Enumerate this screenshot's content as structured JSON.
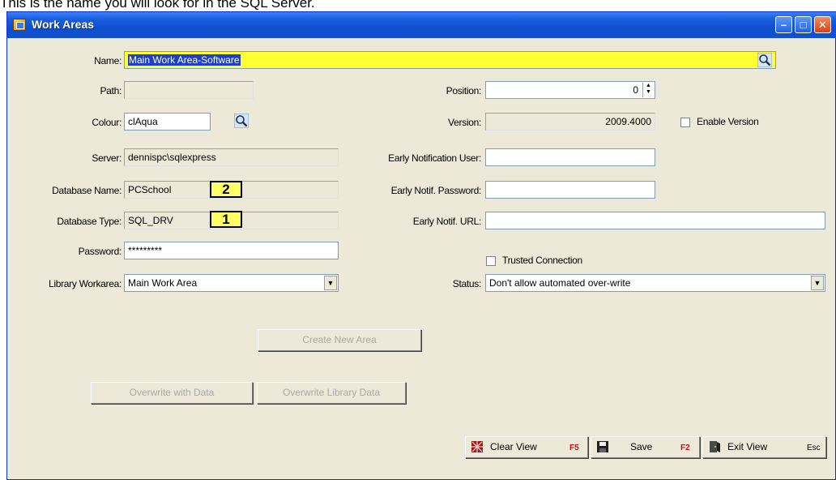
{
  "caption": "This is the name you will look for in the SQL Server.",
  "window": {
    "title": "Work Areas"
  },
  "form": {
    "name_label": "Name:",
    "name_value": "Main Work Area-Software",
    "path_label": "Path:",
    "path_value": "",
    "colour_label": "Colour:",
    "colour_value": "clAqua",
    "server_label": "Server:",
    "server_value": "dennispc\\sqlexpress",
    "dbname_label": "Database Name:",
    "dbname_value": "PCSchool",
    "dbtype_label": "Database Type:",
    "dbtype_value": "SQL_DRV",
    "password_label": "Password:",
    "password_value": "*********",
    "library_label": "Library Workarea:",
    "library_value": "Main Work Area",
    "position_label": "Position:",
    "position_value": "0",
    "version_label": "Version:",
    "version_value": "2009.4000",
    "enable_version_label": "Enable Version",
    "early_user_label": "Early Notification User:",
    "early_user_value": "",
    "early_pwd_label": "Early Notif. Password:",
    "early_pwd_value": "",
    "early_url_label": "Early Notif. URL:",
    "early_url_value": "",
    "trusted_label": "Trusted Connection",
    "status_label": "Status:",
    "status_value": "Don't allow automated over-write"
  },
  "badges": {
    "b1": "1",
    "b2": "2"
  },
  "buttons": {
    "create": "Create New Area",
    "overwrite_data": "Overwrite with Data",
    "overwrite_library": "Overwrite Library Data",
    "clear_view": "Clear View",
    "clear_key": "F5",
    "save": "Save",
    "save_key": "F2",
    "exit_view": "Exit View",
    "exit_key": "Esc"
  },
  "colors": {
    "highlight": "#ffff33",
    "badge": "#ffff66",
    "titlebar": "#0e4fd0"
  }
}
